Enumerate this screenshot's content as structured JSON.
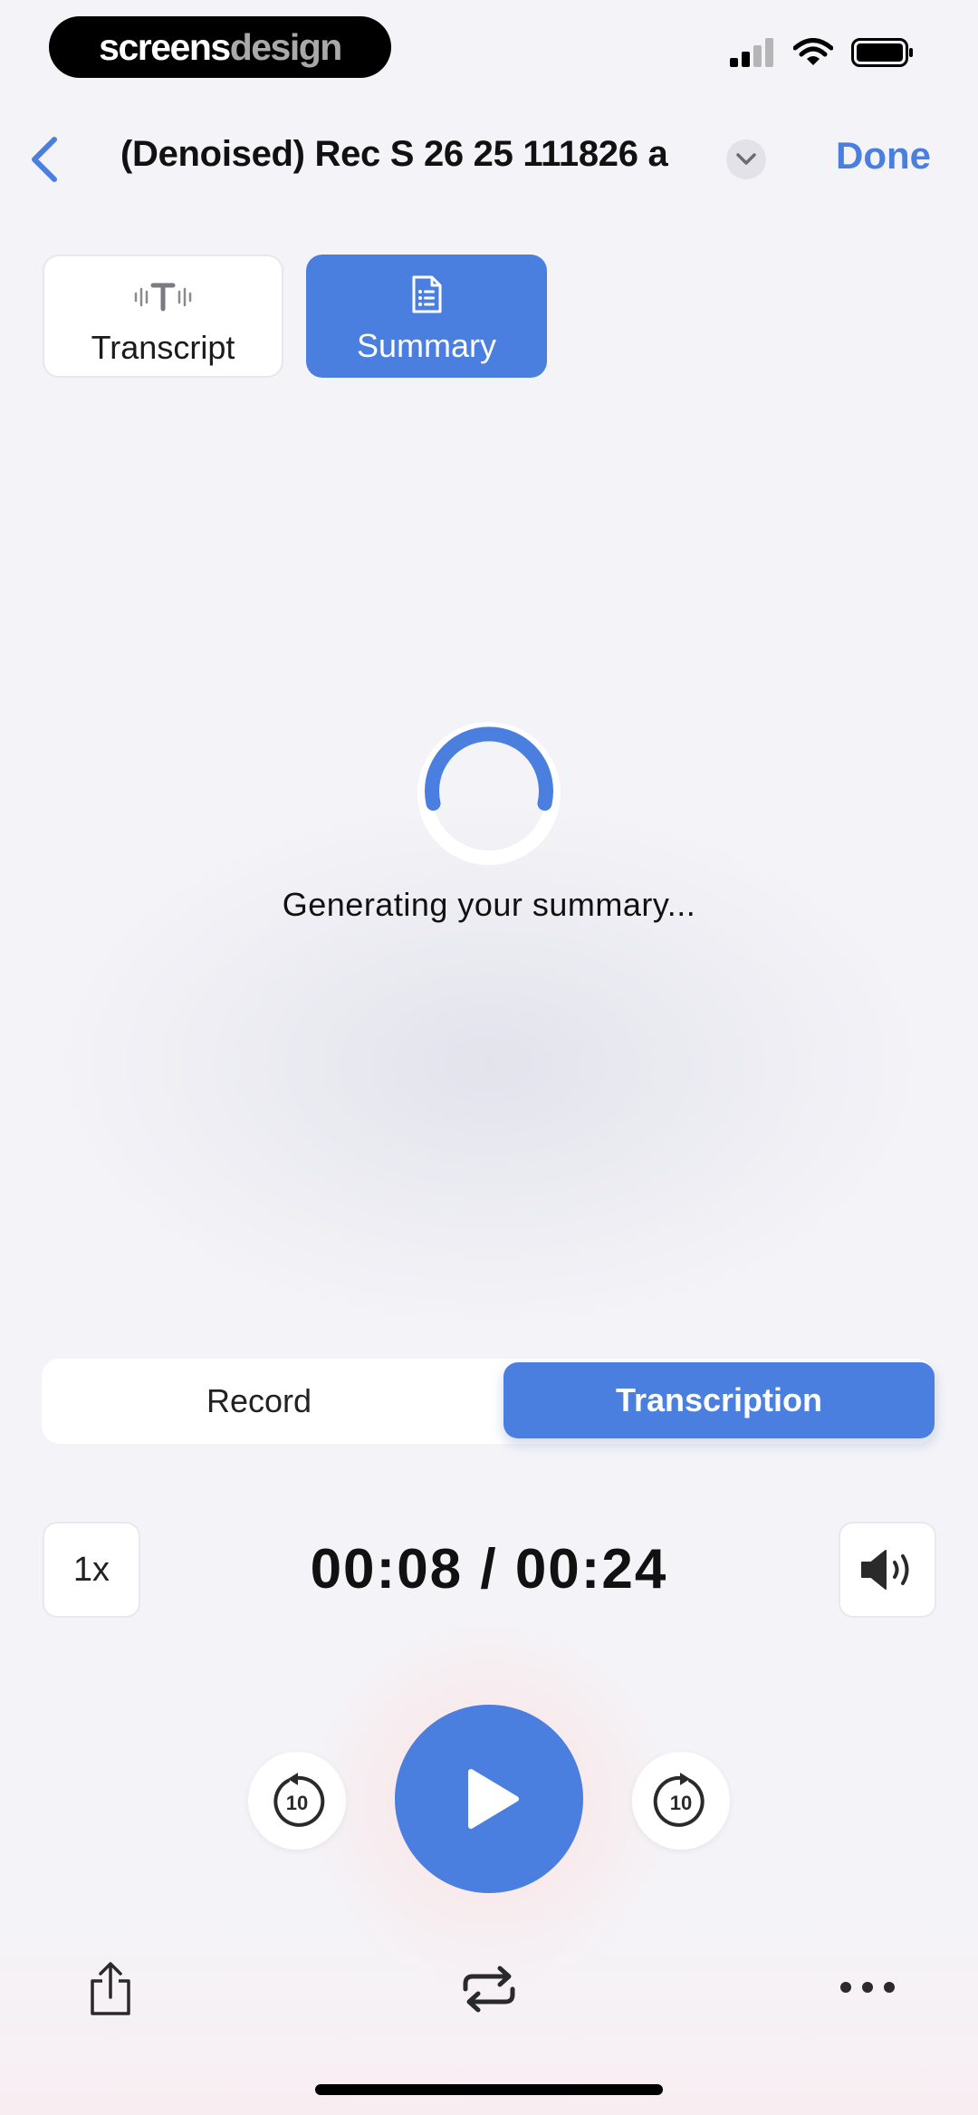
{
  "brand": {
    "part1": "screens",
    "part2": "design"
  },
  "nav": {
    "title": "(Denoised) Rec S 26 25 111826 a",
    "done_label": "Done"
  },
  "tabs": [
    {
      "label": "Transcript",
      "icon": "transcript-waveform-icon",
      "active": false
    },
    {
      "label": "Summary",
      "icon": "document-list-icon",
      "active": true
    }
  ],
  "loading": {
    "text": "Generating your summary..."
  },
  "segment": {
    "options": [
      "Record",
      "Transcription"
    ],
    "selected": "Transcription"
  },
  "player": {
    "speed_label": "1x",
    "time_display": "00:08 / 00:24",
    "skip_back_label": "10",
    "skip_forward_label": "10"
  },
  "colors": {
    "accent": "#4a7fe0",
    "background": "#f4f4f8"
  }
}
